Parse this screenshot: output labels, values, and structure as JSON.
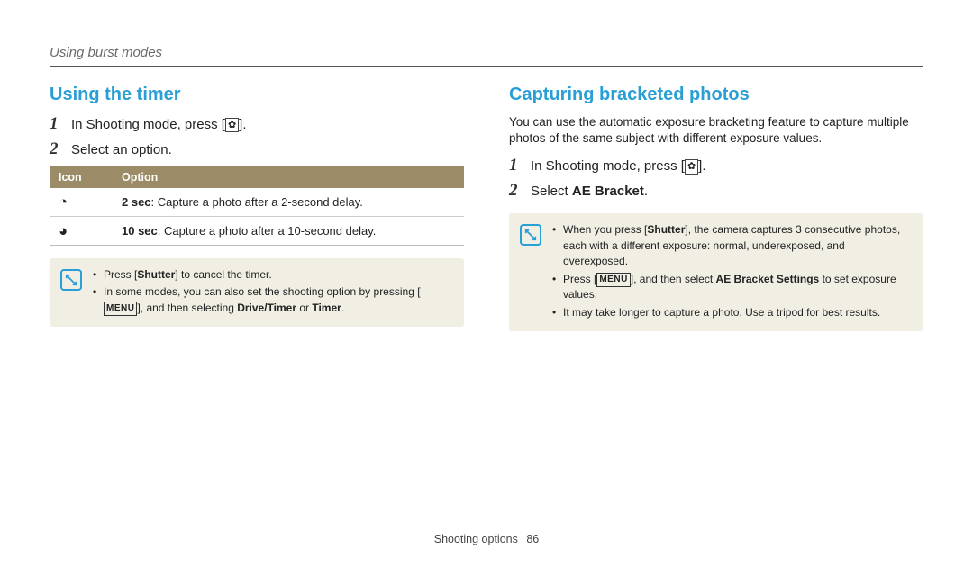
{
  "breadcrumb": "Using burst modes",
  "left": {
    "title": "Using the timer",
    "steps": [
      {
        "num": "1",
        "pre": "In Shooting mode, press [",
        "icon": "drive-mode-icon",
        "post": "]."
      },
      {
        "num": "2",
        "text": "Select an option."
      }
    ],
    "table": {
      "headers": [
        "Icon",
        "Option"
      ],
      "rows": [
        {
          "icon": "timer-2s-icon",
          "bold": "2 sec",
          "rest": ": Capture a photo after a 2-second delay."
        },
        {
          "icon": "timer-10s-icon",
          "bold": "10 sec",
          "rest": ": Capture a photo after a 10-second delay."
        }
      ]
    },
    "note": [
      {
        "parts": [
          "Press [",
          {
            "b": "Shutter"
          },
          "] to cancel the timer."
        ]
      },
      {
        "parts": [
          "In some modes, you can also set the shooting option by pressing [",
          {
            "menu": true
          },
          "], and then selecting ",
          {
            "b": "Drive/Timer"
          },
          " or ",
          {
            "b": "Timer"
          },
          "."
        ]
      }
    ]
  },
  "right": {
    "title": "Capturing bracketed photos",
    "intro": "You can use the automatic exposure bracketing feature to capture multiple photos of the same subject with different exposure values.",
    "steps": [
      {
        "num": "1",
        "pre": "In Shooting mode, press [",
        "icon": "drive-mode-icon",
        "post": "]."
      },
      {
        "num": "2",
        "pre": "Select ",
        "bold": "AE Bracket",
        "post": "."
      }
    ],
    "note": [
      {
        "parts": [
          "When you press [",
          {
            "b": "Shutter"
          },
          "], the camera captures 3 consecutive photos, each with a different exposure: normal, underexposed, and overexposed."
        ]
      },
      {
        "parts": [
          "Press [",
          {
            "menu": true
          },
          "], and then select ",
          {
            "b": "AE Bracket Settings"
          },
          " to set exposure values."
        ]
      },
      {
        "parts": [
          "It may take longer to capture a photo. Use a tripod for best results."
        ]
      }
    ]
  },
  "footer": {
    "section": "Shooting options",
    "page": "86"
  },
  "glyphs": {
    "drive": "✿",
    "timer2": "◔",
    "timer10": "◕",
    "menu": "MENU"
  }
}
